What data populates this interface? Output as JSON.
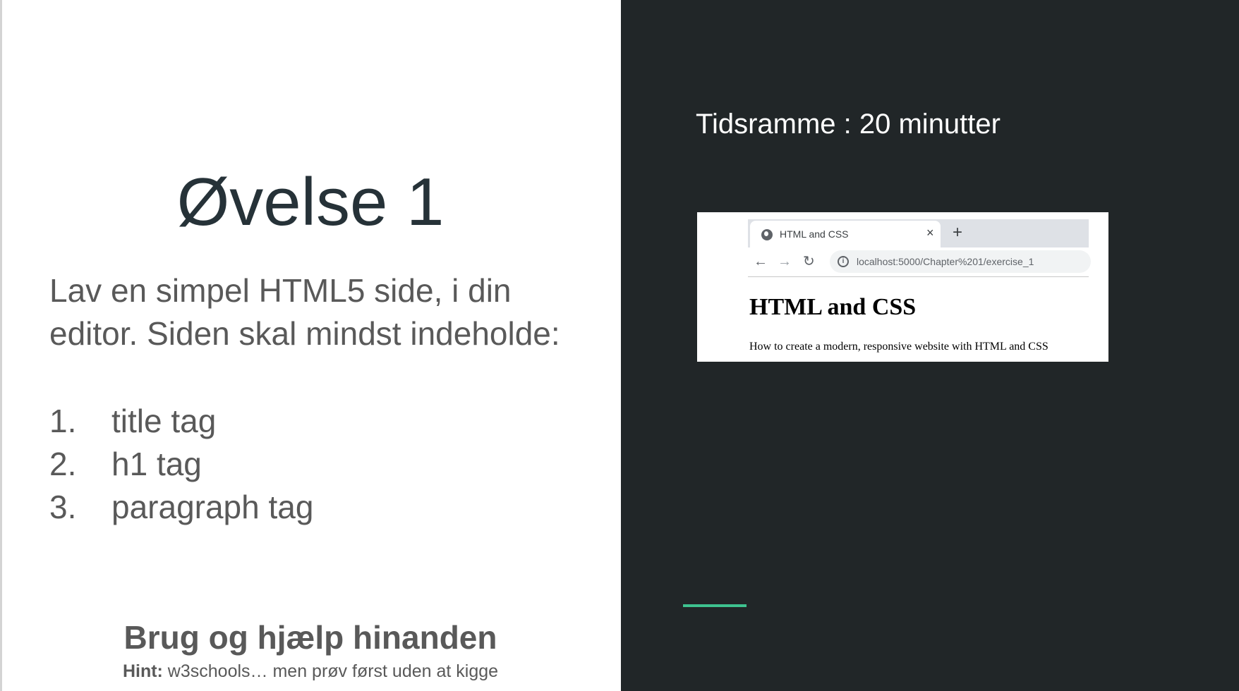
{
  "slide": {
    "title": "Øvelse 1",
    "instructions": "Lav en simpel HTML5 side, i din editor. Siden skal mindst indeholde:",
    "list": [
      {
        "num": "1.",
        "text": "title tag"
      },
      {
        "num": "2.",
        "text": "h1 tag"
      },
      {
        "num": "3.",
        "text": "paragraph tag"
      }
    ],
    "help_heading": "Brug og hjælp hinanden",
    "hint_label": "Hint:",
    "hint_text": " w3schools… men prøv først uden at kigge",
    "timeframe": "Tidsramme : 20 minutter",
    "accent_color": "#3ec28f"
  },
  "browser": {
    "tab_icon": "globe-icon",
    "tab_title": "HTML and CSS",
    "tab_close": "×",
    "new_tab": "+",
    "back_icon": "←",
    "forward_icon": "→",
    "reload_icon": "↻",
    "info_icon": "i",
    "url": "localhost:5000/Chapter%201/exercise_1",
    "page_heading": "HTML and CSS",
    "page_paragraph": "How to create a modern, responsive website with HTML and CSS"
  }
}
